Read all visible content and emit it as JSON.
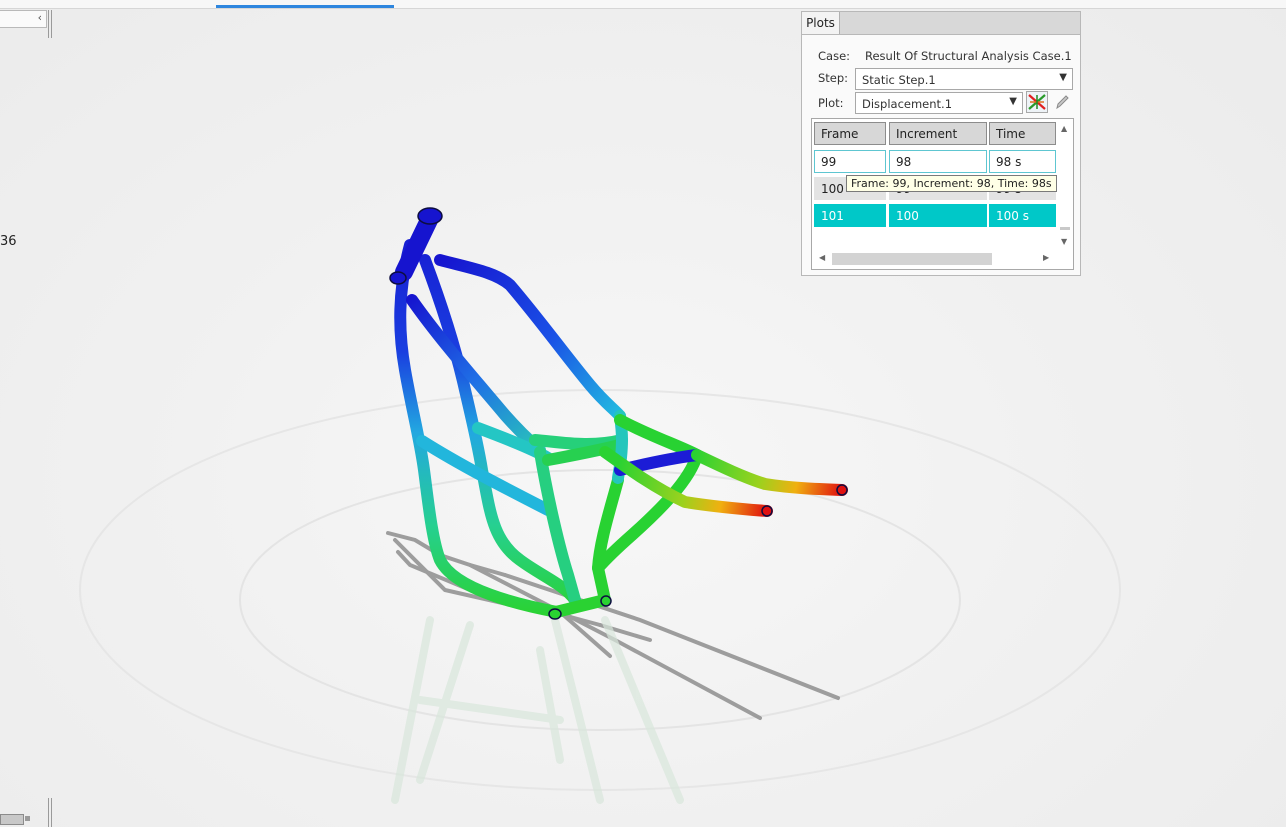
{
  "viewport": {
    "left_readout": "36"
  },
  "plots_panel": {
    "tab_label": "Plots",
    "case_label": "Case:",
    "case_value": "Result Of Structural Analysis Case.1",
    "step_label": "Step:",
    "step_value": "Static Step.1",
    "plot_label": "Plot:",
    "plot_value": "Displacement.1",
    "plot_settings_icon": "contour-settings-icon",
    "edit_icon": "pencil-icon",
    "columns": [
      "Frame",
      "Increment",
      "Time"
    ],
    "rows": [
      {
        "frame": "99",
        "increment": "98",
        "time": "98 s"
      },
      {
        "frame": "100",
        "increment": "99",
        "time": "99 s"
      },
      {
        "frame": "101",
        "increment": "100",
        "time": "100 s"
      }
    ],
    "tooltip": "Frame: 99, Increment: 98, Time: 98s"
  },
  "colors": {
    "selected_row": "#00c8c8",
    "accent": "#2e86de",
    "contour_low": "#1414d2",
    "contour_mid": "#28d22a",
    "contour_high": "#e01010"
  }
}
